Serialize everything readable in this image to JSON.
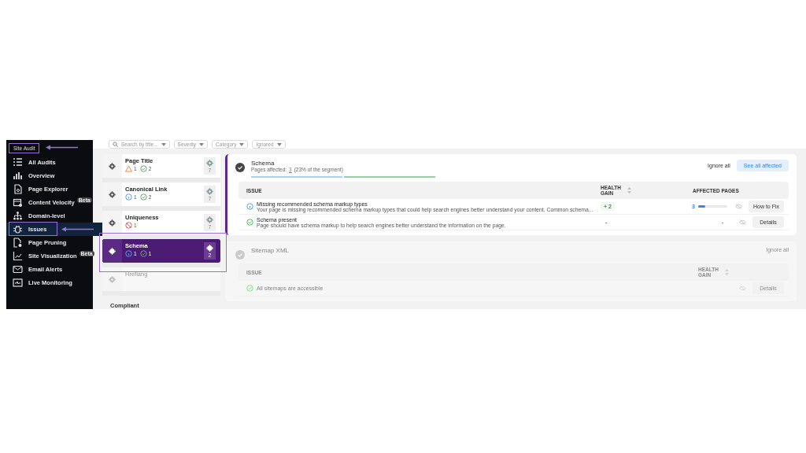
{
  "sidebar": {
    "section": "Site Audit",
    "items": [
      {
        "label": "All Audits",
        "selected": false
      },
      {
        "label": "Overview",
        "selected": false
      },
      {
        "label": "Page Explorer",
        "selected": false
      },
      {
        "label": "Content Velocity",
        "selected": false,
        "badge": "Beta"
      },
      {
        "label": "Domain-level",
        "selected": false
      },
      {
        "label": "Issues",
        "selected": true
      },
      {
        "label": "Page Pruning",
        "selected": false
      },
      {
        "label": "Site Visualization",
        "selected": false,
        "badge": "Beta"
      },
      {
        "label": "Email Alerts",
        "selected": false
      },
      {
        "label": "Live Monitoring",
        "selected": false
      }
    ]
  },
  "filters": [
    {
      "label": "Search by title...",
      "kind": "search"
    },
    {
      "label": "Severity",
      "kind": "dropdown"
    },
    {
      "label": "Category",
      "kind": "dropdown"
    },
    {
      "label": "Ignored",
      "kind": "dropdown"
    }
  ],
  "categories": [
    {
      "title": "Page Title",
      "selected": false,
      "disabled": false,
      "count": "7",
      "stats": [
        {
          "kind": "warning",
          "count": "1"
        },
        {
          "kind": "pass",
          "count": "2"
        }
      ]
    },
    {
      "title": "Canonical Link",
      "selected": false,
      "disabled": false,
      "count": "7",
      "stats": [
        {
          "kind": "info",
          "count": "1"
        },
        {
          "kind": "pass",
          "count": "2"
        }
      ]
    },
    {
      "title": "Uniqueness",
      "selected": false,
      "disabled": false,
      "count": "7",
      "stats": [
        {
          "kind": "error",
          "count": "1"
        }
      ]
    },
    {
      "title": "Schema",
      "selected": true,
      "disabled": false,
      "count": "2",
      "stats": [
        {
          "kind": "info",
          "count": "1"
        },
        {
          "kind": "pass",
          "count": "1"
        }
      ]
    },
    {
      "title": "Hreflang",
      "selected": false,
      "disabled": true
    }
  ],
  "section_heading": "Compliant",
  "panels": [
    {
      "title": "Schema",
      "selected": true,
      "pages_label": "Pages affected:",
      "pages_count": "3",
      "pages_share": "(23% of the segment)",
      "segments": [
        {
          "color": "#a8d4f5"
        },
        {
          "color": "#8fd69a"
        }
      ],
      "ignore_all": "Ignore all",
      "see_all": "See all affected",
      "columns": [
        "ISSUE",
        "HEALTH GAIN",
        "AFFECTED PAGES"
      ],
      "rows": [
        {
          "kind": "info",
          "title": "Missing recommended schema markup types",
          "description": "Your page is missing recommended schema markup types that could help search engines better understand your content. Common schema...",
          "gain": "+ 2",
          "affected": "3",
          "level": 0.25,
          "action": "How to Fix"
        },
        {
          "kind": "pass",
          "title": "Schema present",
          "description": "Page should have schema markup to help search engines better understand the information on the page.",
          "gain": "-",
          "affected": "-",
          "action": "Details"
        }
      ]
    },
    {
      "title": "Sitemap XML",
      "selected": false,
      "ignore_all": "Ignore all",
      "columns": [
        "ISSUE",
        "HEALTH GAIN"
      ],
      "rows": [
        {
          "kind": "pass",
          "title": "All sitemaps are accessible",
          "action": "Details"
        }
      ]
    }
  ]
}
